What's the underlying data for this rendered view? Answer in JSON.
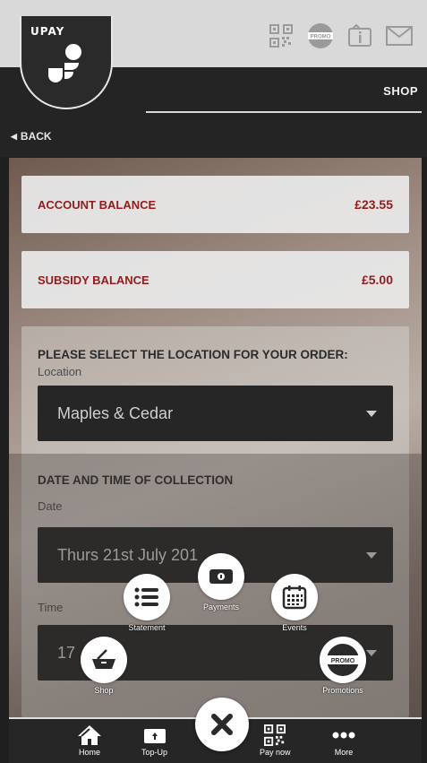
{
  "header": {
    "logo_text": "UPAY",
    "page_title": "SHOP",
    "back_label": "BACK",
    "icons": [
      "qr-code-icon",
      "promo-icon",
      "info-icon",
      "mail-icon"
    ],
    "promo_badge": "PROMO"
  },
  "balances": [
    {
      "label": "ACCOUNT BALANCE",
      "value": "£23.55"
    },
    {
      "label": "SUBSIDY BALANCE",
      "value": "£5.00"
    }
  ],
  "form": {
    "location_heading": "PLEASE SELECT THE LOCATION FOR YOUR ORDER:",
    "location_label": "Location",
    "location_value": "Maples & Cedar",
    "datetime_heading": "DATE AND TIME OF COLLECTION",
    "date_label": "Date",
    "date_value": "Thurs 21st July 201",
    "time_label": "Time",
    "time_value": "17"
  },
  "radial_menu": {
    "payments": "Payments",
    "statement": "Statement",
    "events": "Events",
    "shop": "Shop",
    "promotions": "Promotions",
    "promo_badge": "PROMO"
  },
  "bottom_nav": {
    "home": "Home",
    "topup": "Top-Up",
    "paynow": "Pay now",
    "more": "More"
  },
  "colors": {
    "accent_red": "#8f1d1d",
    "dark": "#262626"
  }
}
